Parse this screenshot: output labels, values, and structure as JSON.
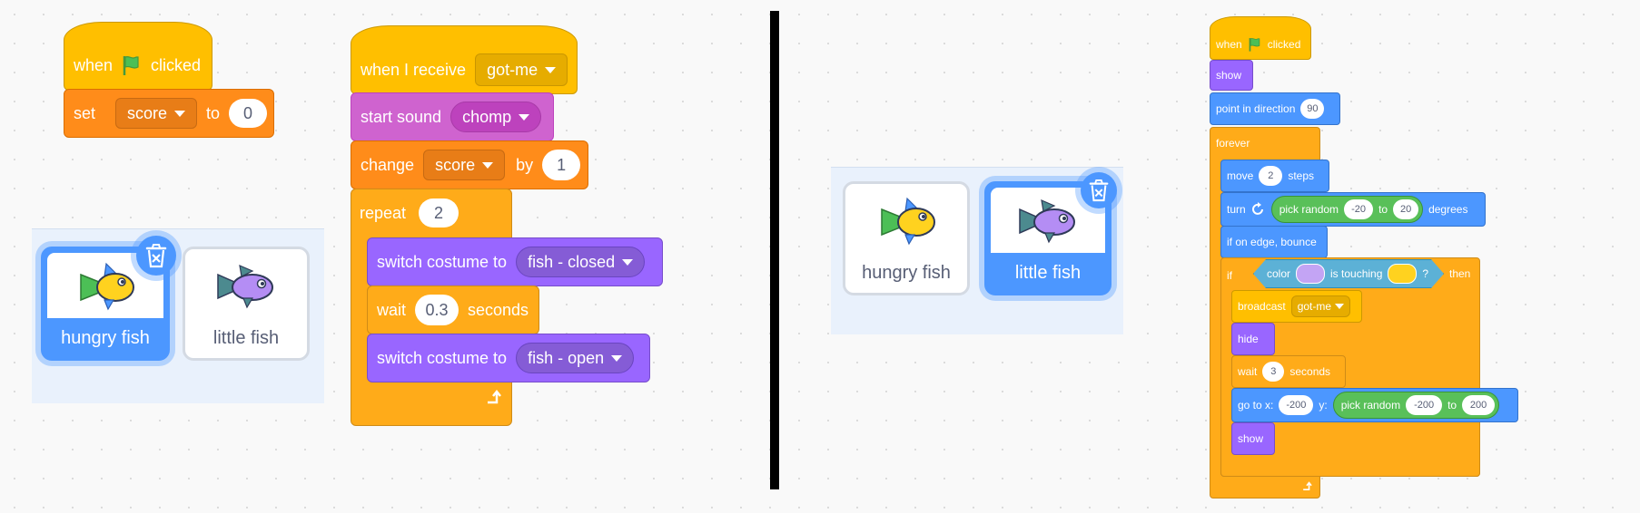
{
  "left": {
    "green_flag_script": {
      "hat": {
        "prefix": "when",
        "suffix": "clicked",
        "icon": "green-flag-icon"
      },
      "set_block": {
        "label": "set",
        "variable": "score",
        "to_label": "to",
        "value": "0"
      }
    },
    "sprites": [
      {
        "name": "hungry fish",
        "selected": true
      },
      {
        "name": "little fish",
        "selected": false
      }
    ],
    "receive_script": {
      "hat": {
        "label": "when I receive",
        "message": "got-me"
      },
      "start_sound": {
        "label": "start sound",
        "sound": "chomp"
      },
      "change": {
        "label": "change",
        "variable": "score",
        "by_label": "by",
        "value": "1"
      },
      "repeat": {
        "label": "repeat",
        "count": "2"
      },
      "switch1": {
        "label": "switch costume to",
        "costume": "fish - closed"
      },
      "wait": {
        "label": "wait",
        "value": "0.3",
        "suffix": "seconds"
      },
      "switch2": {
        "label": "switch costume to",
        "costume": "fish - open"
      }
    }
  },
  "right": {
    "sprites": [
      {
        "name": "hungry fish",
        "selected": false
      },
      {
        "name": "little fish",
        "selected": true
      }
    ],
    "script": {
      "hat": {
        "prefix": "when",
        "suffix": "clicked",
        "icon": "green-flag-icon"
      },
      "show1": "show",
      "point": {
        "label": "point in direction",
        "value": "90"
      },
      "forever": "forever",
      "move": {
        "label": "move",
        "value": "2",
        "suffix": "steps"
      },
      "turn": {
        "label": "turn",
        "suffix": "degrees"
      },
      "pick_random1": {
        "label": "pick random",
        "from": "-20",
        "to_label": "to",
        "to": "20"
      },
      "bounce": "if on edge, bounce",
      "if_block": {
        "label": "if",
        "then": "then"
      },
      "touching": {
        "color_label": "color",
        "is_touching": "is touching",
        "q": "?"
      },
      "broadcast": {
        "label": "broadcast",
        "message": "got-me"
      },
      "hide": "hide",
      "wait": {
        "label": "wait",
        "value": "3",
        "suffix": "seconds"
      },
      "goto": {
        "x_label": "go to x:",
        "x": "-200",
        "y_label": "y:"
      },
      "pick_random2": {
        "label": "pick random",
        "from": "-200",
        "to_label": "to",
        "to": "200"
      },
      "show2": "show"
    }
  },
  "colors": {
    "events": "#ffbf00",
    "variables": "#ff8c1a",
    "sound": "#cf63cf",
    "looks": "#9966ff",
    "control": "#ffab19",
    "motion": "#4c97ff",
    "operators": "#59c059",
    "sensing": "#5cb1d6",
    "touch_color_1": "#c3a4f4",
    "touch_color_2": "#ffd21f"
  }
}
